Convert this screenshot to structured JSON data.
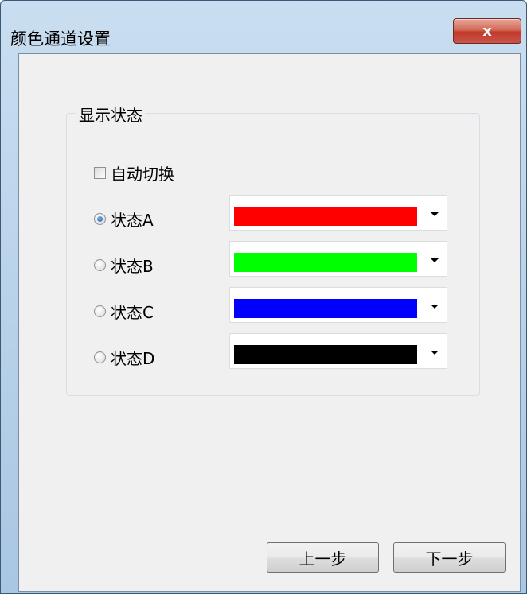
{
  "window": {
    "title": "颜色通道设置",
    "close_label": "x"
  },
  "group": {
    "legend": "显示状态",
    "auto_switch_label": "自动切换",
    "auto_switch_checked": false,
    "states": [
      {
        "label": "状态A",
        "selected": true,
        "color": "#ff0000"
      },
      {
        "label": "状态B",
        "selected": false,
        "color": "#00ff00"
      },
      {
        "label": "状态C",
        "selected": false,
        "color": "#0000ff"
      },
      {
        "label": "状态D",
        "selected": false,
        "color": "#000000"
      }
    ]
  },
  "buttons": {
    "prev": "上一步",
    "next": "下一步"
  }
}
